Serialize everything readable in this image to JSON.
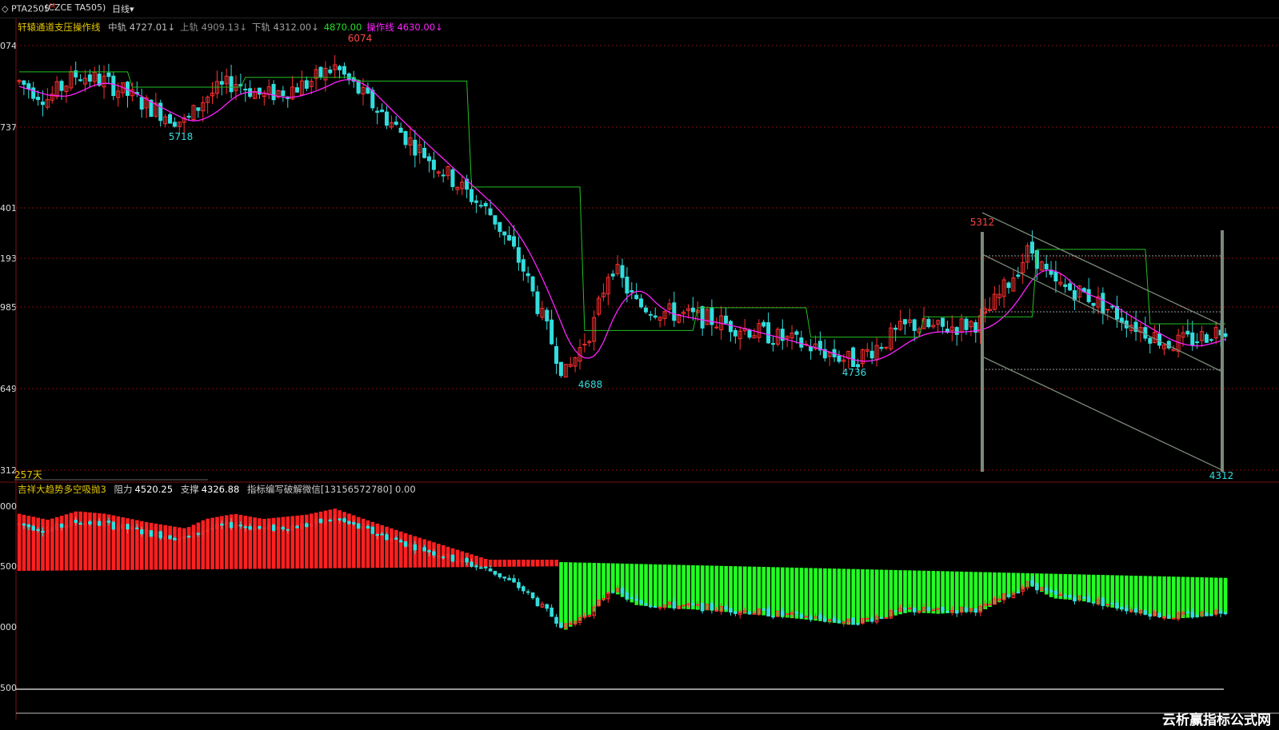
{
  "header": {
    "symbol": "PTA2505",
    "symbol_flag": "M",
    "contract": "(CZCE TA505)",
    "period": "日线",
    "period_caret": "▾"
  },
  "main_panel": {
    "indicator_name": "轩辕通道支压操作线",
    "legend": [
      {
        "label": "中轨",
        "value": "4727.01↓",
        "color": "#bdbdbd"
      },
      {
        "label": "上轨",
        "value": "4909.13↓",
        "color": "#8c8c8c"
      },
      {
        "label": "下轨",
        "value": "4312.00↓",
        "color": "#a0a0a0"
      },
      {
        "label": "",
        "value": "4870.00",
        "color": "#22e022"
      },
      {
        "label": "操作线",
        "value": "4630.00↓",
        "color": "#ff22ff"
      }
    ],
    "y_ticks": [
      "074",
      "737",
      "401",
      "193",
      "985",
      "649",
      "312"
    ],
    "days_label": "257天",
    "price_labels": [
      {
        "text": "6074",
        "color": "#ff4444"
      },
      {
        "text": "5718",
        "color": "#33dddd"
      },
      {
        "text": "4688",
        "color": "#33dddd"
      },
      {
        "text": "4736",
        "color": "#33dddd"
      },
      {
        "text": "5312",
        "color": "#ff4444"
      },
      {
        "text": "4312",
        "color": "#33dddd"
      }
    ]
  },
  "sub_panel": {
    "indicator_name": "吉祥大趋势多空吸抛3",
    "resistance_label": "阻力",
    "resistance_value": "4520.25",
    "support_label": "支撑",
    "support_value": "4326.88",
    "note": "指标编写破解微信[13156572780] 0.00",
    "y_ticks": [
      "000",
      "500",
      "000",
      "500"
    ]
  },
  "watermark": "云析赢指标公式网",
  "colors": {
    "up": "#ff3030",
    "down": "#33dddd",
    "ma": "#ff22ff",
    "green_line": "#22c022",
    "bull_bar": "#ff2020",
    "bear_bar": "#22ff22",
    "grid": "#7a1010",
    "channel": "#7a8a78"
  },
  "chart_data": {
    "type": "candlestick",
    "period": "日线",
    "anchor_highs_lows": [
      {
        "label": "6074",
        "type": "high"
      },
      {
        "label": "5718",
        "type": "low"
      },
      {
        "label": "4688",
        "type": "low"
      },
      {
        "label": "4736",
        "type": "low"
      },
      {
        "label": "5312",
        "type": "high"
      },
      {
        "label": "4312",
        "type": "low"
      }
    ],
    "last_values": {
      "mid": 4727.01,
      "upper": 4909.13,
      "lower": 4312.0,
      "green_line": 4870.0,
      "operation_line": 4630.0,
      "resistance": 4520.25,
      "support": 4326.88
    }
  }
}
